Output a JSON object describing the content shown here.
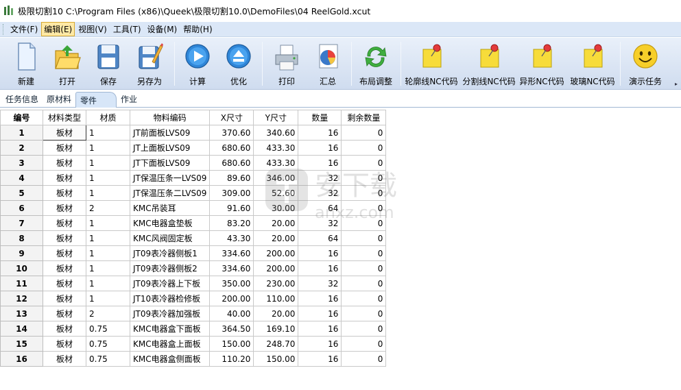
{
  "window": {
    "title": "极限切割10 C:\\Program Files (x86)\\Queek\\极限切割10.0\\DemoFiles\\04 ReelGold.xcut"
  },
  "menu": [
    "文件(F)",
    "编辑(E)",
    "视图(V)",
    "工具(T)",
    "设备(M)",
    "帮助(H)"
  ],
  "toolbar": {
    "new": "新建",
    "open": "打开",
    "save": "保存",
    "save_as": "另存为",
    "calculate": "计算",
    "optimize": "优化",
    "print": "打印",
    "summary": "汇总",
    "layout_adjust": "布局调整",
    "contour_nc": "轮廓线NC代码",
    "split_nc": "分割线NC代码",
    "shape_nc": "异形NC代码",
    "glass_nc": "玻璃NC代码",
    "demo_task": "演示任务",
    "more": "▸"
  },
  "tabs": [
    "任务信息",
    "原材料",
    "零件",
    "作业"
  ],
  "active_tab": 2,
  "grid": {
    "headers": [
      "编号",
      "材料类型",
      "材质",
      "物料编码",
      "X尺寸",
      "Y尺寸",
      "数量",
      "剩余数量"
    ],
    "rows": [
      [
        "1",
        "板材",
        "1",
        "JT前面板LVS09",
        "370.60",
        "340.60",
        "16",
        "0"
      ],
      [
        "2",
        "板材",
        "1",
        "JT上面板LVS09",
        "680.60",
        "433.30",
        "16",
        "0"
      ],
      [
        "3",
        "板材",
        "1",
        "JT下面板LVS09",
        "680.60",
        "433.30",
        "16",
        "0"
      ],
      [
        "4",
        "板材",
        "1",
        "JT保温压条一LVS09",
        "89.60",
        "346.00",
        "32",
        "0"
      ],
      [
        "5",
        "板材",
        "1",
        "JT保温压条二LVS09",
        "309.00",
        "52.60",
        "32",
        "0"
      ],
      [
        "6",
        "板材",
        "2",
        "KMC吊装耳",
        "91.60",
        "30.00",
        "64",
        "0"
      ],
      [
        "7",
        "板材",
        "1",
        "KMC电器盒垫板",
        "83.20",
        "20.00",
        "32",
        "0"
      ],
      [
        "8",
        "板材",
        "1",
        "KMC风阀固定板",
        "43.30",
        "20.00",
        "64",
        "0"
      ],
      [
        "9",
        "板材",
        "1",
        "JT09表冷器侧板1",
        "334.60",
        "200.00",
        "16",
        "0"
      ],
      [
        "10",
        "板材",
        "1",
        "JT09表冷器侧板2",
        "334.60",
        "200.00",
        "16",
        "0"
      ],
      [
        "11",
        "板材",
        "1",
        "JT09表冷器上下板",
        "350.00",
        "230.00",
        "32",
        "0"
      ],
      [
        "12",
        "板材",
        "1",
        "JT10表冷器检修板",
        "200.00",
        "110.00",
        "16",
        "0"
      ],
      [
        "13",
        "板材",
        "2",
        "JT09表冷器加强板",
        "40.00",
        "20.00",
        "16",
        "0"
      ],
      [
        "14",
        "板材",
        "0.75",
        "KMC电器盒下面板",
        "364.50",
        "169.10",
        "16",
        "0"
      ],
      [
        "15",
        "板材",
        "0.75",
        "KMC电器盒上面板",
        "150.00",
        "248.70",
        "16",
        "0"
      ],
      [
        "16",
        "板材",
        "0.75",
        "KMC电器盒侧面板",
        "110.20",
        "150.00",
        "16",
        "0"
      ]
    ]
  },
  "watermark": {
    "line1": "安下载",
    "line2": "anxz.com"
  },
  "colors": {
    "menubar": "#dbe7f7",
    "toolbar": "#cfdcef",
    "active_menu": "#ffe9a6",
    "grid_border": "#c8c8c8"
  }
}
